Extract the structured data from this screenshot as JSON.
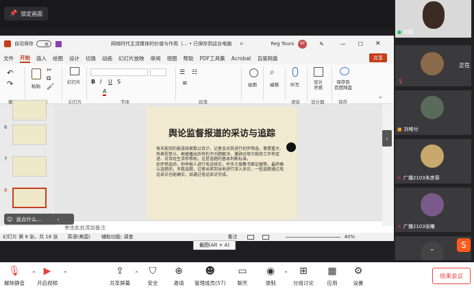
{
  "lock": {
    "label": "锁定画面"
  },
  "ppt": {
    "autosave_label": "自动保存",
    "autosave_state": "关",
    "doc_title": "网络时代主流媒体的价值与作用（...  • 已保存到这台电脑",
    "user_name": "Reg Tours",
    "user_initials": "RT",
    "share_label": "共享",
    "menus": [
      "文件",
      "开始",
      "插入",
      "绘图",
      "设计",
      "切换",
      "动画",
      "幻灯片放映",
      "审阅",
      "视图",
      "帮助",
      "PDF工具集",
      "Acrobat",
      "百度网盘"
    ],
    "ribbon": {
      "paste": "粘贴",
      "new_slide": "幻灯片",
      "drawing": "绘图",
      "editing": "编辑",
      "dictate": "听写",
      "designer": "设计\n灵感",
      "save_baidu": "保存到\n百度网盘",
      "groups": [
        "撤消",
        "剪贴板",
        "幻灯片",
        "字体",
        "段落",
        "语音",
        "设计器",
        "保存"
      ]
    },
    "thumb_numbers": [
      "6",
      "7",
      "8"
    ],
    "slide": {
      "title": "舆论监督报道的采访与追踪",
      "body": "每天能到的报道线索数以百计，记者会对其进行初步筛选，事情重大、有典型意义、根据播出后有利于问题解决、兼顾对地方政府工作有促进、对百姓生活有帮助，这是选题的基本判断标准。\n初步筛选后，和举报人进行电话核实，并多方搜集书面证据等，最终确认选题后，多数选题，记者出差到当地进行深入采访，一些选题通过电话采访也能确实，如通过电话采访完成。"
    },
    "notes_placeholder": "单击此处添加备注",
    "status": {
      "slide_info": "幻灯片 第 8 张，共 18 张",
      "lang": "英语(美国)",
      "access": "辅助功能: 调查",
      "notes": "备注",
      "zoom": "40%"
    }
  },
  "chat": {
    "placeholder": "说点什么..."
  },
  "tooltip": "截图(Alt + A)",
  "participants": [
    {
      "name": "刘黎"
    },
    {
      "name": "正在"
    },
    {
      "name": ""
    },
    {
      "name": "刘唯付"
    },
    {
      "name": "广播2103朱彦蓉"
    },
    {
      "name": "广播2103张曦"
    },
    {
      "name": ""
    }
  ],
  "toolbar": {
    "mute": "解除静音",
    "video": "开启视频",
    "share": "共享屏幕",
    "security": "安全",
    "invite": "邀请",
    "members": "管理成员(57)",
    "chat": "聊天",
    "record": "录制",
    "breakout": "分组讨论",
    "apps": "应用",
    "settings": "设置",
    "end": "结束会议"
  },
  "colors": {
    "accent": "#c43e1c",
    "end": "#e64340"
  }
}
